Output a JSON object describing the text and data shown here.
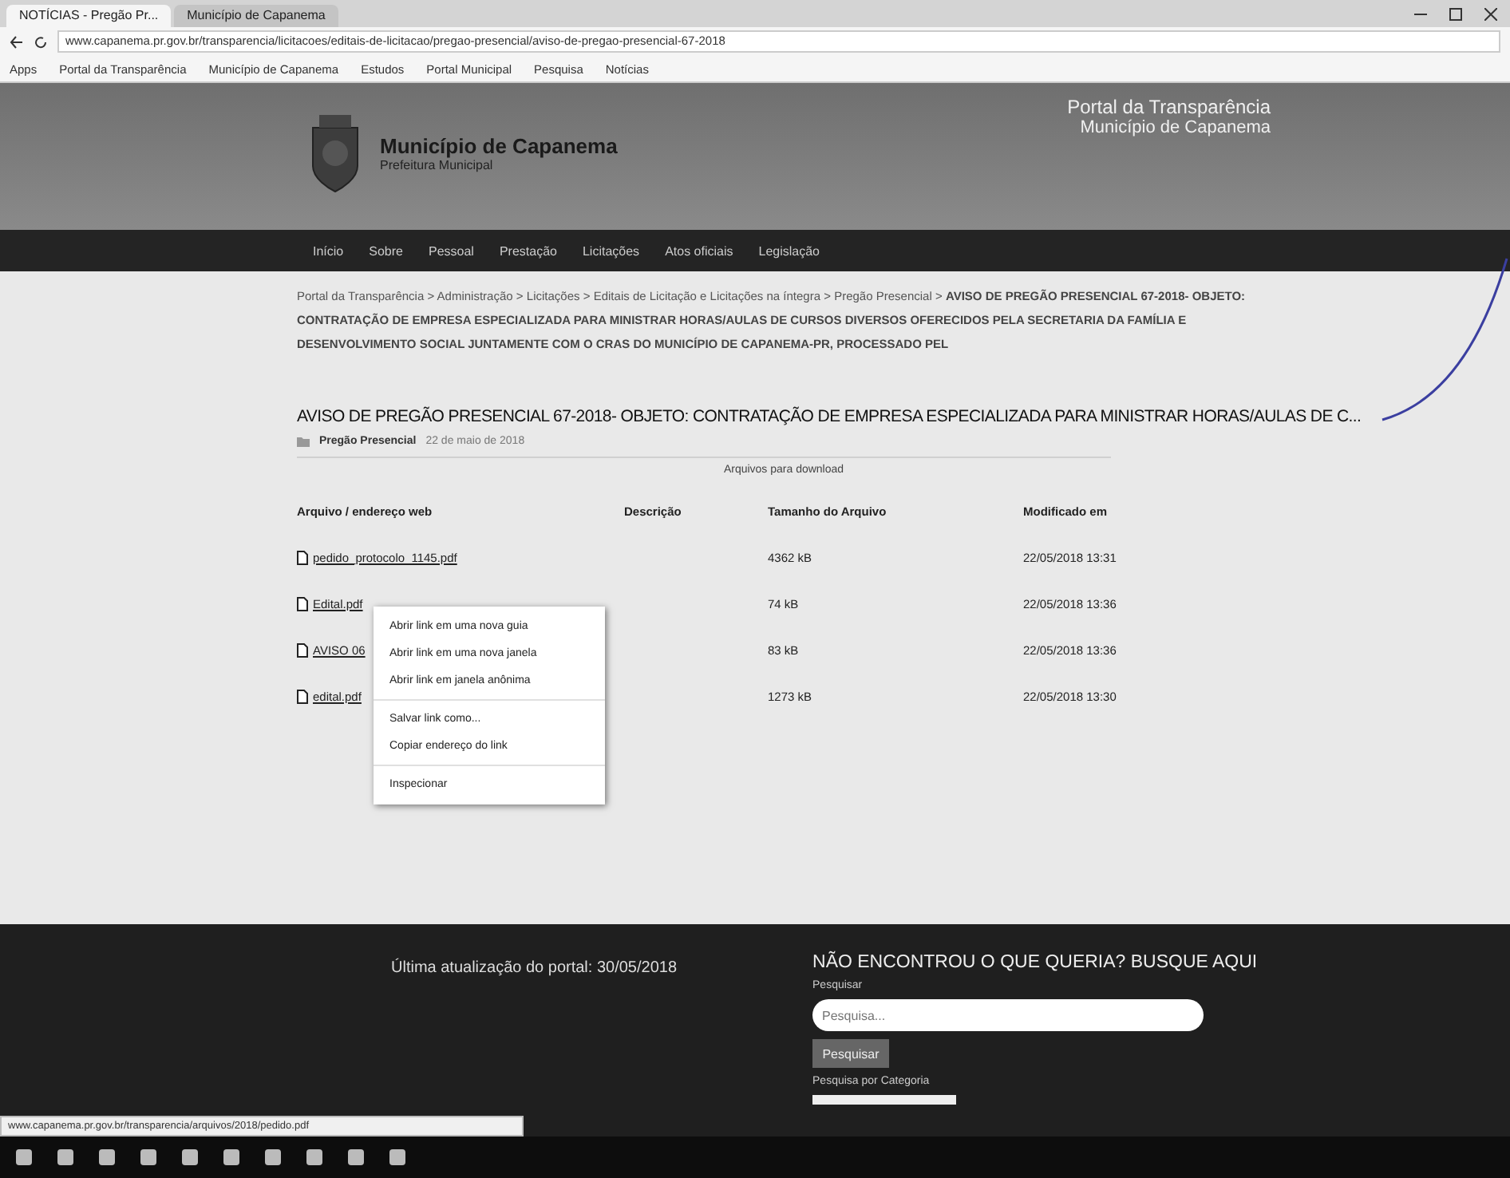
{
  "browser": {
    "tabs": [
      {
        "label": "NOTÍCIAS - Pregão Pr...",
        "selected": true
      },
      {
        "label": "Município de Capanema",
        "selected": false
      }
    ],
    "address": "www.capanema.pr.gov.br/transparencia/licitacoes/editais-de-licitacao/pregao-presencial/aviso-de-pregao-presencial-67-2018",
    "bookmarks": [
      "Apps",
      "Portal da Transparência",
      "Município de Capanema",
      "Estudos",
      "Portal Municipal",
      "Pesquisa",
      "Notícias"
    ]
  },
  "header": {
    "site_name": "Município de Capanema",
    "site_subtitle": "Prefeitura Municipal",
    "portal_title": "Portal da Transparência",
    "portal_subtitle": "Município de Capanema"
  },
  "nav": [
    "Início",
    "Sobre",
    "Pessoal",
    "Prestação",
    "Licitações",
    "Atos oficiais",
    "Legislação"
  ],
  "breadcrumb": {
    "separator": ">",
    "path": [
      "Portal da Transparência",
      "Administração",
      "Licitações",
      "Editais de Licitação e Licitações na íntegra",
      "Pregão Presencial"
    ],
    "current": "AVISO DE PREGÃO PRESENCIAL 67-2018- OBJETO: CONTRATAÇÃO DE EMPRESA ESPECIALIZADA PARA MINISTRAR HORAS/AULAS DE CURSOS DIVERSOS OFERECIDOS PELA SECRETARIA DA FAMÍLIA E DESENVOLVIMENTO SOCIAL JUNTAMENTE COM O CRAS DO MUNICÍPIO DE CAPANEMA-PR, PROCESSADO PEL"
  },
  "title": "AVISO DE PREGÃO PRESENCIAL 67-2018- OBJETO: CONTRATAÇÃO DE EMPRESA ESPECIALIZADA PARA MINISTRAR HORAS/AULAS DE C...",
  "meta": {
    "category": "Pregão Presencial",
    "date": "22 de maio de 2018"
  },
  "downloads": {
    "caption": "Arquivos para download",
    "columns": [
      "Arquivo / endereço web",
      "Descrição",
      "Tamanho do Arquivo",
      "Modificado em"
    ],
    "rows": [
      {
        "file": "pedido_protocolo_1145.pdf",
        "size": "4362 kB",
        "modified": "22/05/2018 13:31"
      },
      {
        "file": "Edital.pdf",
        "size": "74 kB",
        "modified": "22/05/2018 13:36"
      },
      {
        "file": "AVISO 06",
        "size": "83 kB",
        "modified": "22/05/2018 13:36"
      },
      {
        "file": "edital.pdf",
        "size": "1273 kB",
        "modified": "22/05/2018 13:30"
      }
    ]
  },
  "context_menu": [
    {
      "label": "Abrir link em uma nova guia",
      "kind": "item"
    },
    {
      "label": "Abrir link em uma nova janela",
      "kind": "item"
    },
    {
      "label": "Abrir link em janela anônima",
      "kind": "item"
    },
    {
      "kind": "separator"
    },
    {
      "label": "Salvar link como...",
      "kind": "item"
    },
    {
      "label": "Copiar endereço do link",
      "kind": "item"
    },
    {
      "kind": "separator"
    },
    {
      "label": "Inspecionar",
      "kind": "item"
    }
  ],
  "footer": {
    "updated": "Última atualização do portal: 30/05/2018",
    "search_title": "NÃO ENCONTROU O QUE QUERIA? BUSQUE AQUI",
    "search_label": "Pesquisar",
    "search_placeholder": "Pesquisa...",
    "search_button": "Pesquisar",
    "category_label": "Pesquisa por Categoria"
  },
  "status_url": "www.capanema.pr.gov.br/transparencia/arquivos/2018/pedido.pdf"
}
